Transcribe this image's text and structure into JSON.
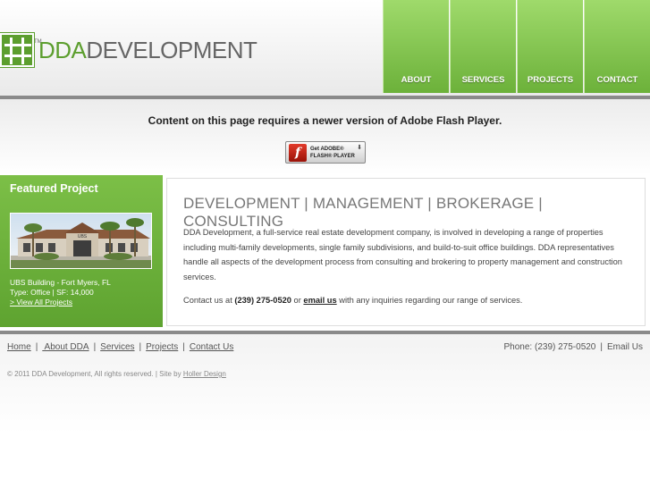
{
  "logo": {
    "brand": "DDA",
    "name": "DEVELOPMENT",
    "tm": "TM"
  },
  "nav": [
    {
      "label": "ABOUT"
    },
    {
      "label": "SERVICES"
    },
    {
      "label": "PROJECTS"
    },
    {
      "label": "CONTACT"
    }
  ],
  "flash": {
    "message": "Content on this page requires a newer version of Adobe Flash Player.",
    "button_line1": "Get ADOBE®",
    "button_line2": "FLASH® PLAYER",
    "icon": "f"
  },
  "featured": {
    "title": "Featured Project",
    "building": "UBS Building - Fort Myers, FL",
    "details": "Type: Office | SF: 14,000",
    "link": "> View All Projects",
    "sign": "UBS"
  },
  "main": {
    "heading": "DEVELOPMENT | MANAGEMENT | BROKERAGE | CONSULTING",
    "paragraph": "DDA Development, a full-service real estate development company, is involved in developing a range of properties including multi-family developments, single family subdivisions, and build-to-suit office buildings. DDA representatives handle all aspects of the development process from consulting and brokering to property management and construction services.",
    "contact_prefix": "Contact us at",
    "phone": "(239) 275-0520",
    "or": "or",
    "email_label": "email us",
    "contact_suffix": "with any inquiries regarding our range of services."
  },
  "footer": {
    "links": [
      {
        "label": "Home"
      },
      {
        "label": " About DDA"
      },
      {
        "label": "Services"
      },
      {
        "label": "Projects"
      },
      {
        "label": "Contact Us"
      }
    ],
    "phone": "Phone: (239) 275-0520",
    "email": "Email Us",
    "copyright": "© 2011 DDA Development, All rights reserved. | Site by",
    "designer": "Holler Design"
  },
  "colors": {
    "brand_green": "#5c9e2e",
    "nav_green": "#7cc04a",
    "bar_gray": "#8a8a8a"
  }
}
